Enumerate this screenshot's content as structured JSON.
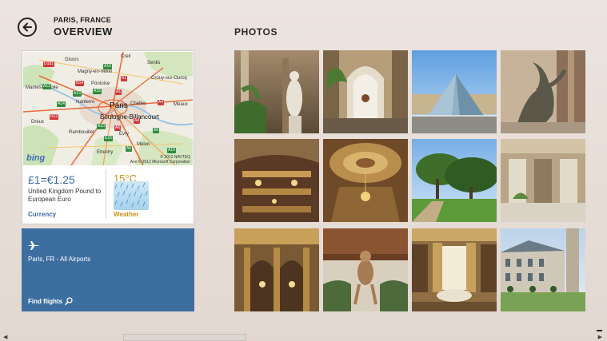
{
  "header": {
    "location": "PARIS, FRANCE",
    "title": "OVERVIEW",
    "photos_title": "PHOTOS"
  },
  "map": {
    "brand": "bing",
    "copyright_line1": "© 2012 NAVTEQ",
    "copyright_line2": "Ave © 2012 Microsoft Corporation",
    "labels": {
      "gisors": "Gisors",
      "creil": "Creil",
      "senlis": "Senlis",
      "crouy": "Crouy-sur-Ourcq",
      "magny": "Magny-en-Vexin",
      "mantes": "Mantes-la-Jolie",
      "pontoise": "Pontoise",
      "nanterre": "Nanterre",
      "paris": "Paris",
      "chelles": "Chelles",
      "meaux": "Meaux",
      "boulogne": "Boulogne-Billancourt",
      "dreux": "Dreux",
      "rambouillet": "Rambouillet",
      "evry": "Evry",
      "melun": "Melun",
      "etrechy": "Etrechy"
    },
    "roads": [
      "D181",
      "A16",
      "A1",
      "A13",
      "A15",
      "N14",
      "A1",
      "A4",
      "A13",
      "A14",
      "N12",
      "A10",
      "A6",
      "A5",
      "A19",
      "E15",
      "A6",
      "A4"
    ]
  },
  "currency": {
    "rate": "£1=€1.25",
    "description": "United Kingdom Pound to European Euro",
    "label": "Currency"
  },
  "weather": {
    "temperature": "15°C",
    "label": "Weather",
    "icon": "rain-icon"
  },
  "flights": {
    "route": "Paris, FR - All Airports",
    "action": "Find flights",
    "icon": "airplane-icon"
  },
  "photos": [
    {
      "name": "photo-palace-statue"
    },
    {
      "name": "photo-arcade-interior"
    },
    {
      "name": "photo-louvre-pyramid"
    },
    {
      "name": "photo-bronze-sculpture"
    },
    {
      "name": "photo-opera-balconies"
    },
    {
      "name": "photo-ornate-ceiling"
    },
    {
      "name": "photo-garden-trees"
    },
    {
      "name": "photo-mirror-hall"
    },
    {
      "name": "photo-opera-hall"
    },
    {
      "name": "photo-carved-beam"
    },
    {
      "name": "photo-salon-window"
    },
    {
      "name": "photo-chateau-courtyard"
    }
  ],
  "colors": {
    "accent_blue": "#3d6ea0",
    "currency_blue": "#3c6aa4",
    "weather_orange": "#c8901a"
  }
}
